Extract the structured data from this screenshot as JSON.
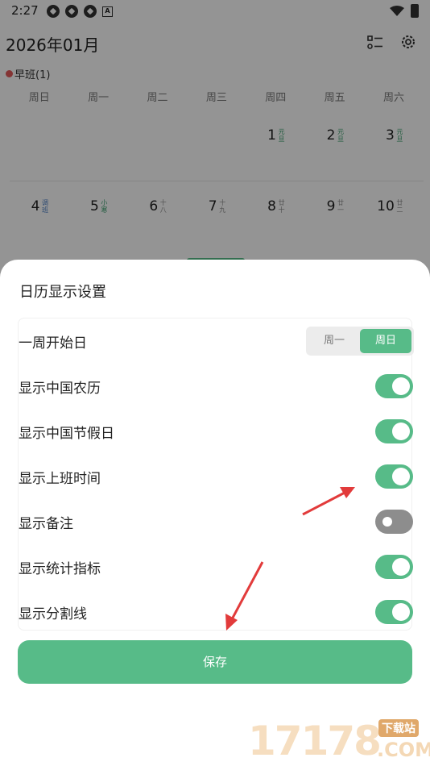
{
  "status_bar": {
    "time": "2:27",
    "badge_letter": "A"
  },
  "calendar": {
    "month_title": "2026年01月",
    "shift_label": "早班(1)",
    "weekdays": [
      "周日",
      "周一",
      "周二",
      "周三",
      "周四",
      "周五",
      "周六"
    ],
    "week1": [
      {
        "num": "1",
        "sub": "元旦",
        "color": "#3a9e6c"
      },
      {
        "num": "2",
        "sub": "元旦",
        "color": "#3a9e6c"
      },
      {
        "num": "3",
        "sub": "元旦",
        "color": "#3a9e6c"
      }
    ],
    "week2": [
      {
        "num": "4",
        "sub": "调班",
        "color": "#4b7fc4"
      },
      {
        "num": "5",
        "sub": "小寒",
        "color": "#3a9e6c"
      },
      {
        "num": "6",
        "sub": "十八",
        "color": "#888888"
      },
      {
        "num": "7",
        "sub": "十九",
        "color": "#888888"
      },
      {
        "num": "8",
        "sub": "廿十",
        "color": "#888888"
      },
      {
        "num": "9",
        "sub": "廿一",
        "color": "#888888"
      },
      {
        "num": "10",
        "sub": "廿二",
        "color": "#888888"
      }
    ]
  },
  "sheet": {
    "title": "日历显示设置",
    "week_start": {
      "label": "一周开始日",
      "options": [
        "周一",
        "周日"
      ],
      "selected": "周日"
    },
    "settings": [
      {
        "label": "显示中国农历",
        "on": true
      },
      {
        "label": "显示中国节假日",
        "on": true
      },
      {
        "label": "显示上班时间",
        "on": true
      },
      {
        "label": "显示备注",
        "on": false
      },
      {
        "label": "显示统计指标",
        "on": true
      },
      {
        "label": "显示分割线",
        "on": true
      }
    ],
    "save_label": "保存"
  },
  "colors": {
    "accent": "#57bb88",
    "toggle_off": "#8d8d8d",
    "arrow": "#e23b3b"
  },
  "watermark": {
    "digits": "17178",
    "tag": "下载站",
    "suffix": ".COM"
  }
}
